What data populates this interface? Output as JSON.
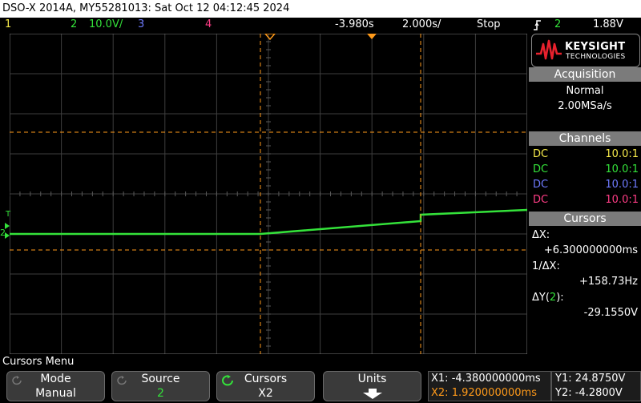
{
  "title": "DSO-X 2014A, MY55281013: Sat Oct 12 04:12:45 2024",
  "status": {
    "ch1": "1",
    "ch2": "2",
    "ch2_scale": "10.0V/",
    "ch3": "3",
    "ch4": "4",
    "time_offset": "-3.980s",
    "time_scale": "2.000s/",
    "run_state": "Stop",
    "trigger_icon": "trigger-edge-icon",
    "trigger_channel": "2",
    "trigger_level": "1.88V"
  },
  "colors": {
    "ch1": "#f5e94a",
    "ch2": "#34e23a",
    "ch3": "#6f7bff",
    "ch4": "#ff3d86",
    "cursor": "#ff9a1a",
    "panel_header": "#7b7b7b"
  },
  "brand": {
    "line1": "KEYSIGHT",
    "line2": "TECHNOLOGIES"
  },
  "acquisition": {
    "header": "Acquisition",
    "mode": "Normal",
    "rate": "2.00MSa/s"
  },
  "channels": {
    "header": "Channels",
    "rows": [
      {
        "coupling": "DC",
        "probe": "10.0:1"
      },
      {
        "coupling": "DC",
        "probe": "10.0:1"
      },
      {
        "coupling": "DC",
        "probe": "10.0:1"
      },
      {
        "coupling": "DC",
        "probe": "10.0:1"
      }
    ]
  },
  "cursors": {
    "header": "Cursors",
    "dx_label": "ΔX:",
    "dx_value": "+6.300000000ms",
    "inv_dx_label": "1/ΔX:",
    "inv_dx_value": "+158.73Hz",
    "dy_label_pre": "ΔY(",
    "dy_channel": "2",
    "dy_label_post": "):",
    "dy_value": "-29.1550V"
  },
  "softkeys": {
    "menu_title": "Cursors Menu",
    "mode_label": "Mode",
    "mode_value": "Manual",
    "source_label": "Source",
    "source_value": "2",
    "cursors_label": "Cursors",
    "cursors_value": "X2",
    "units_label": "Units"
  },
  "readouts": {
    "x1": "X1: -4.380000000ms",
    "x2": "X2: 1.920000000ms",
    "y1": "Y1: 24.8750V",
    "y2": "Y2: -4.2800V"
  },
  "markers": {
    "trigger_label": "T",
    "channel_label": "2"
  }
}
